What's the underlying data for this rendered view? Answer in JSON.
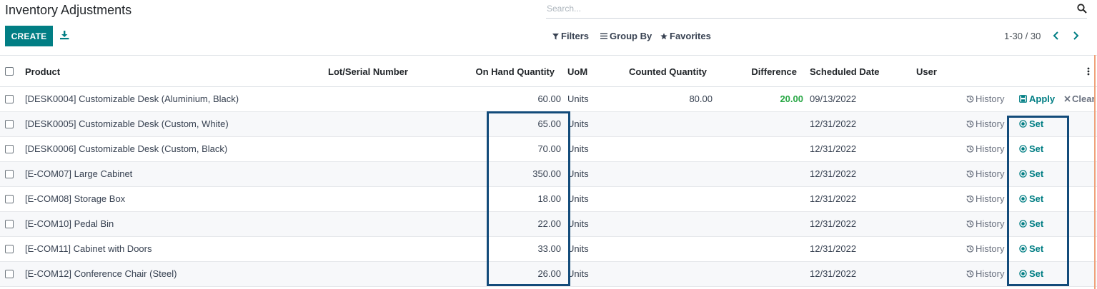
{
  "page": {
    "title": "Inventory Adjustments"
  },
  "search": {
    "placeholder": "Search..."
  },
  "toolbar": {
    "create_label": "CREATE",
    "filters_label": "Filters",
    "group_by_label": "Group By",
    "favorites_label": "Favorites",
    "pager_text": "1-30 / 30"
  },
  "columns": {
    "product": "Product",
    "lot": "Lot/Serial Number",
    "on_hand": "On Hand Quantity",
    "uom": "UoM",
    "counted": "Counted Quantity",
    "difference": "Difference",
    "scheduled": "Scheduled Date",
    "user": "User"
  },
  "rows": [
    {
      "product": "[DESK0004] Customizable Desk (Aluminium, Black)",
      "on_hand": "60.00",
      "uom": "Units",
      "counted": "80.00",
      "difference": "20.00",
      "date": "09/13/2022",
      "history": "History",
      "action": "Apply",
      "clear": "Clear"
    },
    {
      "product": "[DESK0005] Customizable Desk (Custom, White)",
      "on_hand": "65.00",
      "uom": "Units",
      "counted": "",
      "difference": "",
      "date": "12/31/2022",
      "history": "History",
      "action": "Set"
    },
    {
      "product": "[DESK0006] Customizable Desk (Custom, Black)",
      "on_hand": "70.00",
      "uom": "Units",
      "counted": "",
      "difference": "",
      "date": "12/31/2022",
      "history": "History",
      "action": "Set"
    },
    {
      "product": "[E-COM07] Large Cabinet",
      "on_hand": "350.00",
      "uom": "Units",
      "counted": "",
      "difference": "",
      "date": "12/31/2022",
      "history": "History",
      "action": "Set"
    },
    {
      "product": "[E-COM08] Storage Box",
      "on_hand": "18.00",
      "uom": "Units",
      "counted": "",
      "difference": "",
      "date": "12/31/2022",
      "history": "History",
      "action": "Set"
    },
    {
      "product": "[E-COM10] Pedal Bin",
      "on_hand": "22.00",
      "uom": "Units",
      "counted": "",
      "difference": "",
      "date": "12/31/2022",
      "history": "History",
      "action": "Set"
    },
    {
      "product": "[E-COM11] Cabinet with Doors",
      "on_hand": "33.00",
      "uom": "Units",
      "counted": "",
      "difference": "",
      "date": "12/31/2022",
      "history": "History",
      "action": "Set"
    },
    {
      "product": "[E-COM12] Conference Chair (Steel)",
      "on_hand": "26.00",
      "uom": "Units",
      "counted": "",
      "difference": "",
      "date": "12/31/2022",
      "history": "History",
      "action": "Set"
    }
  ],
  "colors": {
    "brand": "#017e84",
    "difference_positive": "#28a745",
    "highlight_box": "#134b7a"
  }
}
